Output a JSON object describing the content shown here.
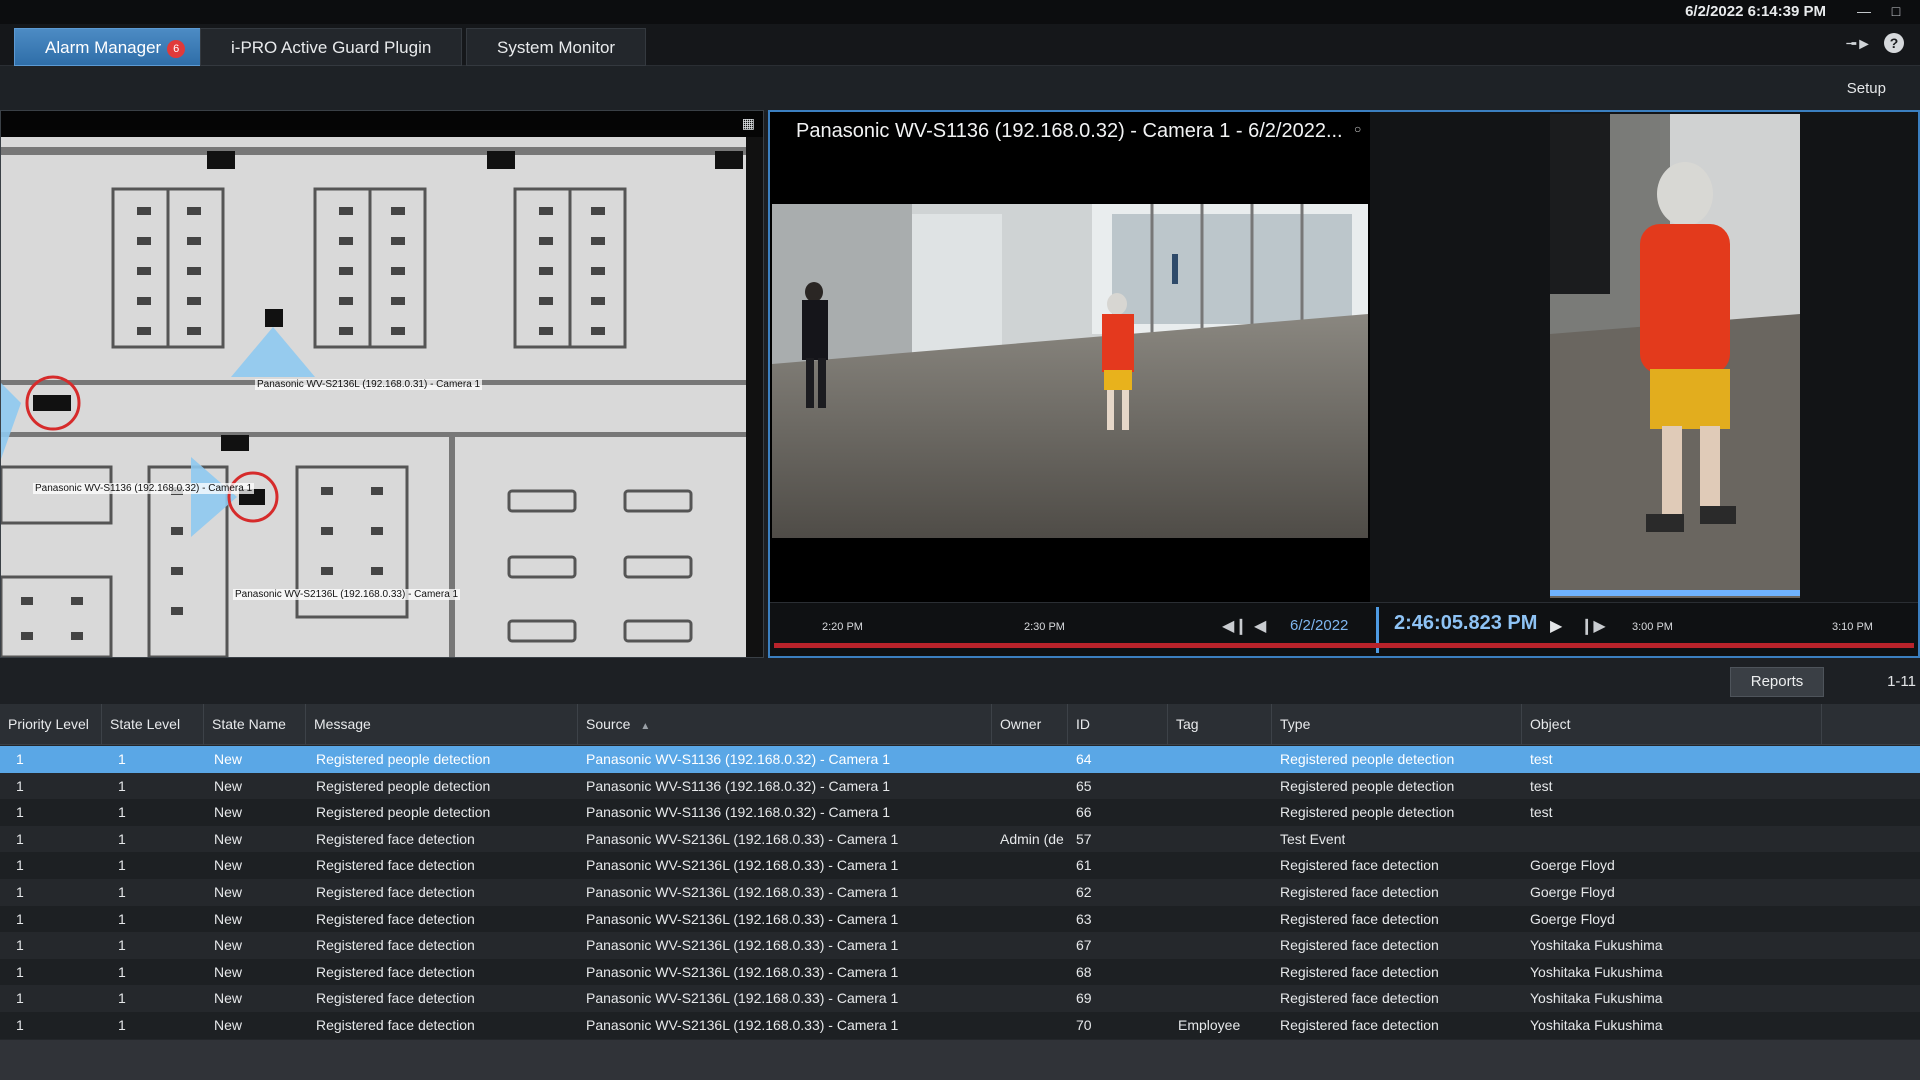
{
  "titlebar": {
    "datetime": "6/2/2022 6:14:39 PM"
  },
  "tabs": [
    {
      "label": "Alarm Manager",
      "badge": "6",
      "active": true
    },
    {
      "label": "i-PRO Active Guard Plugin"
    },
    {
      "label": "System Monitor"
    }
  ],
  "setup_label": "Setup",
  "map": {
    "cameras": [
      {
        "label": "Panasonic WV-S2136L (192.168.0.31) - Camera 1"
      },
      {
        "label": "Panasonic WV-S1136 (192.168.0.32) - Camera 1"
      },
      {
        "label": "Panasonic WV-S2136L (192.168.0.33) - Camera 1"
      }
    ]
  },
  "video": {
    "title": "Panasonic WV-S1136 (192.168.0.32) - Camera 1 - 6/2/2022...",
    "close": "○"
  },
  "timeline": {
    "ticks": [
      "2:20 PM",
      "2:30 PM",
      "3:00 PM",
      "3:10 PM"
    ],
    "date": "6/2/2022",
    "time": "2:46:05.823 PM"
  },
  "reports_label": "Reports",
  "range": "1-11",
  "table": {
    "columns": [
      "Priority Level",
      "State Level",
      "State Name",
      "Message",
      "Source",
      "Owner",
      "ID",
      "Tag",
      "Type",
      "Object"
    ],
    "rows": [
      [
        "1",
        "1",
        "New",
        "Registered people detection",
        "Panasonic WV-S1136 (192.168.0.32) - Camera 1",
        "",
        "64",
        "",
        "Registered people detection",
        "test"
      ],
      [
        "1",
        "1",
        "New",
        "Registered people detection",
        "Panasonic WV-S1136 (192.168.0.32) - Camera 1",
        "",
        "65",
        "",
        "Registered people detection",
        "test"
      ],
      [
        "1",
        "1",
        "New",
        "Registered people detection",
        "Panasonic WV-S1136 (192.168.0.32) - Camera 1",
        "",
        "66",
        "",
        "Registered people detection",
        "test"
      ],
      [
        "1",
        "1",
        "New",
        "Registered face detection",
        "Panasonic WV-S2136L (192.168.0.33) - Camera 1",
        "Admin (de",
        "57",
        "",
        "Test Event",
        ""
      ],
      [
        "1",
        "1",
        "New",
        "Registered face detection",
        "Panasonic WV-S2136L (192.168.0.33) - Camera 1",
        "",
        "61",
        "",
        "Registered face detection",
        "Goerge Floyd"
      ],
      [
        "1",
        "1",
        "New",
        "Registered face detection",
        "Panasonic WV-S2136L (192.168.0.33) - Camera 1",
        "",
        "62",
        "",
        "Registered face detection",
        "Goerge Floyd"
      ],
      [
        "1",
        "1",
        "New",
        "Registered face detection",
        "Panasonic WV-S2136L (192.168.0.33) - Camera 1",
        "",
        "63",
        "",
        "Registered face detection",
        "Goerge Floyd"
      ],
      [
        "1",
        "1",
        "New",
        "Registered face detection",
        "Panasonic WV-S2136L (192.168.0.33) - Camera 1",
        "",
        "67",
        "",
        "Registered face detection",
        "Yoshitaka Fukushima"
      ],
      [
        "1",
        "1",
        "New",
        "Registered face detection",
        "Panasonic WV-S2136L (192.168.0.33) - Camera 1",
        "",
        "68",
        "",
        "Registered face detection",
        "Yoshitaka Fukushima"
      ],
      [
        "1",
        "1",
        "New",
        "Registered face detection",
        "Panasonic WV-S2136L (192.168.0.33) - Camera 1",
        "",
        "69",
        "",
        "Registered face detection",
        "Yoshitaka Fukushima"
      ],
      [
        "1",
        "1",
        "New",
        "Registered face detection",
        "Panasonic WV-S2136L (192.168.0.33) - Camera 1",
        "",
        "70",
        "Employee",
        "Registered face detection",
        "Yoshitaka Fukushima"
      ]
    ],
    "selected_row": 0
  },
  "icons": {
    "expand": "expand-icon",
    "pin": "pin-icon",
    "help": "help-icon",
    "play": "play-icon",
    "step_back": "skip-back-icon",
    "prev": "previous-icon",
    "step_forward": "step-forward-icon",
    "minimize": "minimize-icon",
    "maximize": "maximize-icon"
  },
  "colors": {
    "accent": "#3b7fc0",
    "selected_row": "#5aa7e6",
    "alert_red": "#d62b2b"
  }
}
